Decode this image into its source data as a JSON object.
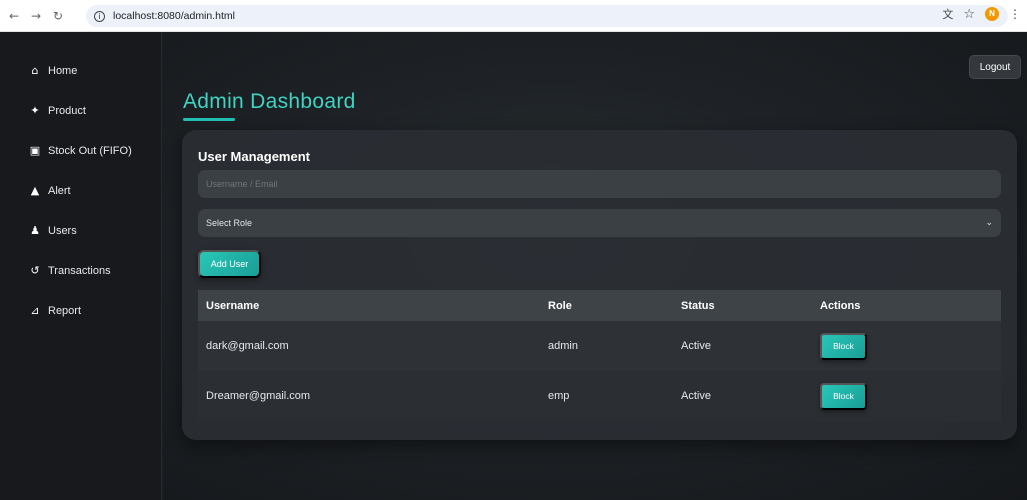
{
  "browser": {
    "back": "←",
    "forward": "→",
    "reload": "↻",
    "url": "localhost:8080/admin.html",
    "profile_initial": "N"
  },
  "sidebar": {
    "items": [
      {
        "label": "Home",
        "icon": "home-icon",
        "glyph": "⌂"
      },
      {
        "label": "Product",
        "icon": "product-icon",
        "glyph": "✦"
      },
      {
        "label": "Stock Out (FIFO)",
        "icon": "truck-icon",
        "glyph": "▣"
      },
      {
        "label": "Alert",
        "icon": "alert-icon",
        "glyph": "▲"
      },
      {
        "label": "Users",
        "icon": "user-icon",
        "glyph": "♟"
      },
      {
        "label": "Transactions",
        "icon": "history-icon",
        "glyph": "↺"
      },
      {
        "label": "Report",
        "icon": "chart-icon",
        "glyph": "⊿"
      }
    ]
  },
  "header": {
    "logout_label": "Logout",
    "title": "Admin Dashboard"
  },
  "card": {
    "title": "User Management",
    "input_placeholder": "Username / Email",
    "select_value": "Select Role",
    "add_label": "Add User",
    "columns": [
      "Username",
      "Role",
      "Status",
      "Actions"
    ],
    "rows": [
      {
        "username": "dark@gmail.com",
        "role": "admin",
        "status": "Active",
        "action": "Block"
      },
      {
        "username": "Dreamer@gmail.com",
        "role": "emp",
        "status": "Active",
        "action": "Block"
      }
    ]
  },
  "colors": {
    "accent": "#22c1b3",
    "title": "#3fd3c2",
    "sidebar_bg": "#17191c",
    "card_bg": "#2a2e33"
  }
}
